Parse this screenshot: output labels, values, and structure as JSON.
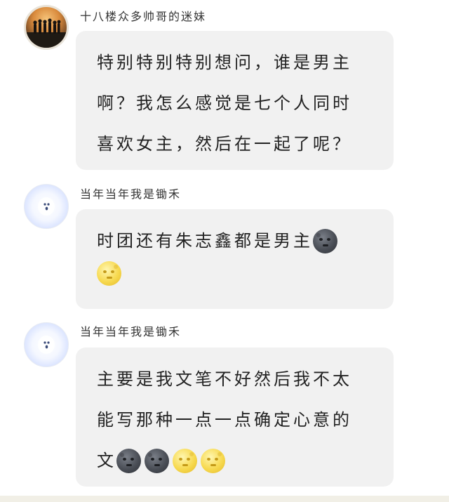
{
  "comments": [
    {
      "username": "十八楼众多帅哥的迷妹",
      "avatar_icon": "sunset-group-photo-avatar",
      "lines": [
        [
          {
            "text": "特别特别特别想问，谁是男主"
          }
        ],
        [
          {
            "text": "啊？我怎么感觉是七个人同时"
          }
        ],
        [
          {
            "text": "喜欢女主，然后在一起了呢？"
          }
        ]
      ]
    },
    {
      "username": "当年当年我是锄禾",
      "avatar_icon": "ghost-avatar",
      "lines": [
        [
          {
            "text": "时团还有朱志鑫都是男主"
          },
          {
            "emoji": "new-moon-face"
          }
        ],
        [
          {
            "emoji": "full-moon-face"
          }
        ]
      ]
    },
    {
      "username": "当年当年我是锄禾",
      "avatar_icon": "ghost-avatar",
      "lines": [
        [
          {
            "text": "主要是我文笔不好然后我不太"
          }
        ],
        [
          {
            "text": "能写那种一点一点确定心意的"
          }
        ],
        [
          {
            "text": "文"
          },
          {
            "emoji": "new-moon-face"
          },
          {
            "emoji": "new-moon-face"
          },
          {
            "emoji": "full-moon-face"
          },
          {
            "emoji": "full-moon-face"
          }
        ]
      ]
    }
  ]
}
